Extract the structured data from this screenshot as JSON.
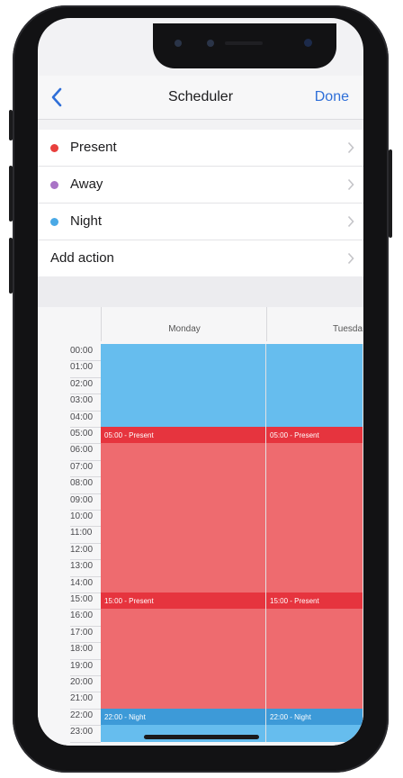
{
  "navbar": {
    "back_icon": "chevron-left-icon",
    "title": "Scheduler",
    "done_label": "Done"
  },
  "actions": [
    {
      "label": "Present",
      "color": "#e8403d"
    },
    {
      "label": "Away",
      "color": "#a974c6"
    },
    {
      "label": "Night",
      "color": "#4aa9e6"
    }
  ],
  "add_action_label": "Add action",
  "calendar": {
    "days": [
      "Monday",
      "Tuesda"
    ],
    "hours": [
      "00:00",
      "01:00",
      "02:00",
      "03:00",
      "04:00",
      "05:00",
      "06:00",
      "07:00",
      "08:00",
      "09:00",
      "10:00",
      "11:00",
      "12:00",
      "13:00",
      "14:00",
      "15:00",
      "16:00",
      "17:00",
      "18:00",
      "19:00",
      "20:00",
      "21:00",
      "22:00",
      "23:00"
    ],
    "events": [
      {
        "label": "05:00 - Present",
        "monday": "05:00 - Present",
        "tuesday": "05:00 - Present"
      },
      {
        "label": "15:00 - Present",
        "monday": "15:00 - Present",
        "tuesday": "15:00 - Present"
      },
      {
        "label": "22:00 - Night",
        "monday": "22:00 - Night",
        "tuesday": "22:00 - Night"
      }
    ],
    "colors": {
      "night": "#66bdee",
      "night_dark": "#3d9ad8",
      "present": "#ee6b6f",
      "present_dark": "#e6343e"
    }
  }
}
